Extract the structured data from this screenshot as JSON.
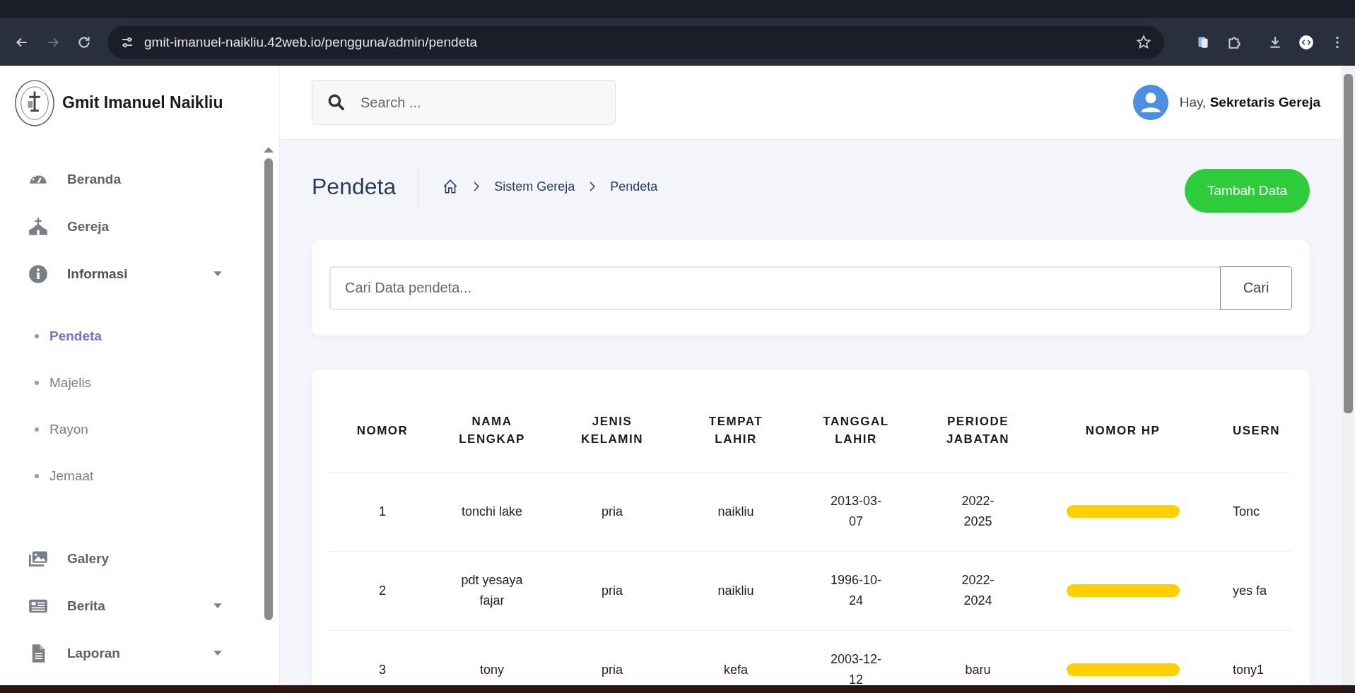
{
  "browser": {
    "url": "gmit-imanuel-naikliu.42web.io/pengguna/admin/pendeta"
  },
  "sidebar": {
    "brand": "Gmit Imanuel Naikliu",
    "items": [
      {
        "label": "Beranda"
      },
      {
        "label": "Gereja"
      },
      {
        "label": "Informasi",
        "expanded": true,
        "children": [
          {
            "label": "Pendeta",
            "selected": true
          },
          {
            "label": "Majelis",
            "selected": false
          },
          {
            "label": "Rayon",
            "selected": false
          },
          {
            "label": "Jemaat",
            "selected": false
          }
        ]
      },
      {
        "label": "Galery"
      },
      {
        "label": "Berita",
        "expanded": false
      },
      {
        "label": "Laporan",
        "expanded": false
      }
    ]
  },
  "header": {
    "search_placeholder": "Search ...",
    "greeting": "Hay, **Sekretaris Gereja**"
  },
  "page": {
    "title": "Pendeta",
    "breadcrumb": [
      "Sistem Gereja",
      "Pendeta"
    ],
    "add_button": "Tambah Data"
  },
  "filter": {
    "placeholder": "Cari Data pendeta...",
    "button": "Cari"
  },
  "table": {
    "columns": [
      "NOMOR",
      "NAMA LENGKAP",
      "JENIS KELAMIN",
      "TEMPAT LAHIR",
      "TANGGAL LAHIR",
      "PERIODE JABATAN",
      "NOMOR HP",
      "USERN"
    ],
    "rows": [
      {
        "cells": [
          "1",
          "tonchi lake",
          "pria",
          "naikliu",
          "2013-03-07",
          "2022-2025",
          "",
          "Tonc"
        ],
        "phone_redacted": true
      },
      {
        "cells": [
          "2",
          "pdt yesaya fajar",
          "pria",
          "naikliu",
          "1996-10-24",
          "2022-2024",
          "",
          "yes fa"
        ],
        "phone_redacted": true
      },
      {
        "cells": [
          "3",
          "tony",
          "pria",
          "kefa",
          "2003-12-12",
          "baru",
          "",
          "tony1"
        ],
        "phone_redacted": true
      }
    ]
  }
}
